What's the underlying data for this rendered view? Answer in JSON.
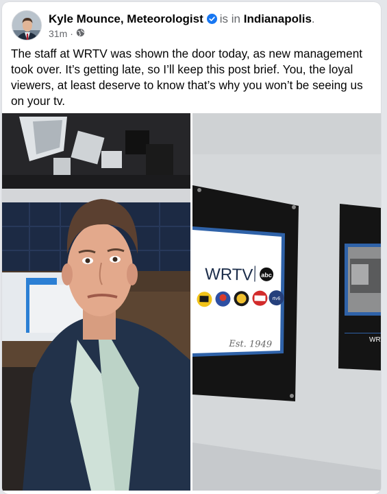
{
  "post": {
    "author": "Kyle Mounce, Meteorologist",
    "is_in": "is in",
    "location": "Indianapolis",
    "location_suffix": ".",
    "time": "31m",
    "dot": "·",
    "privacy_icon": "globe-icon",
    "verified_icon": "verified-badge-icon",
    "text": "The staff at WRTV was shown the door today, as new management took over. It’s getting late, so I’ll keep this post brief. You, the loyal viewers, at least deserve to know that’s why you won’t be seeing us on your tv."
  },
  "photo_right": {
    "sign_title": "WRTV",
    "abc_logo": "abc",
    "badge_rtv6": "rtv6",
    "signature": "Est. 1949",
    "frame2_text": "WRT"
  },
  "colors": {
    "verified_blue": "#1877f2",
    "card_bg": "#ffffff",
    "page_bg": "#e4e6ea",
    "muted_text": "#65676b"
  }
}
